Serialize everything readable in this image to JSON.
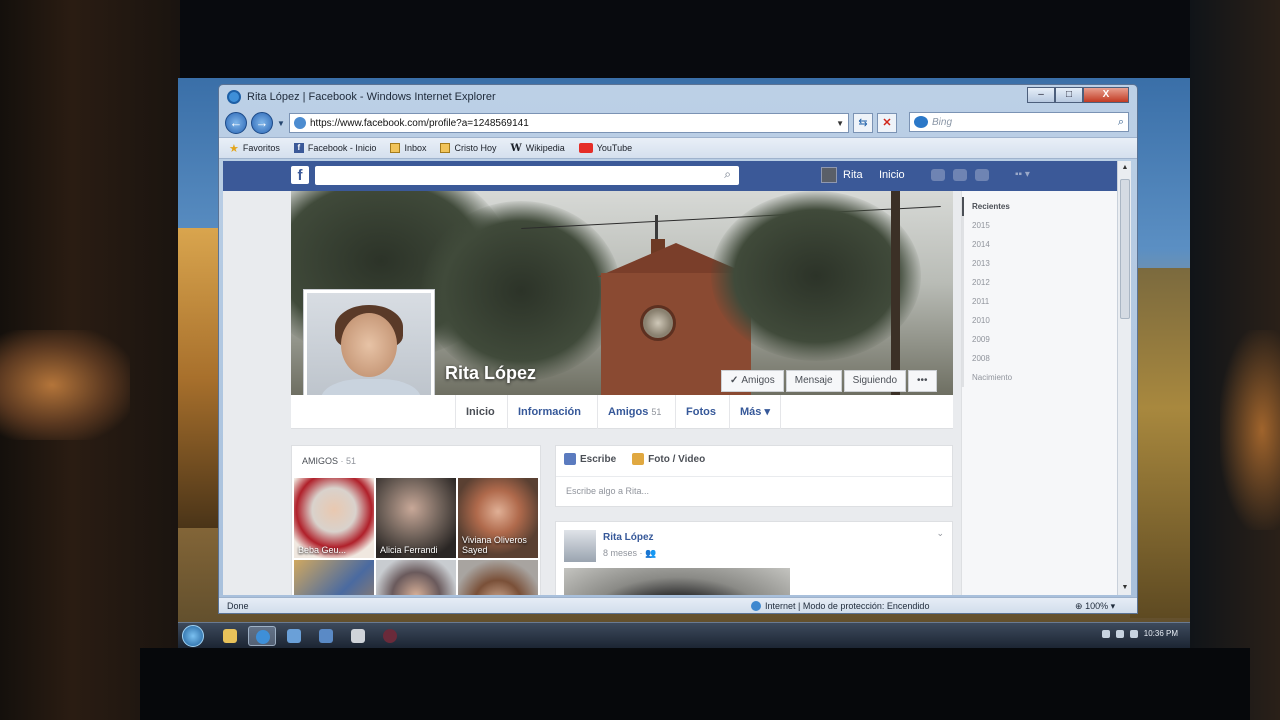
{
  "window": {
    "title": "Rita López | Facebook - Windows Internet Explorer",
    "controls": {
      "minimize": "–",
      "maximize": "□",
      "close": "X"
    }
  },
  "toolbar": {
    "back": "←",
    "forward": "→",
    "url": "https://www.facebook.com/profile?a=1248569141",
    "refresh": "⇆",
    "stop": "✕",
    "search_placeholder": "Bing"
  },
  "favorites": [
    {
      "label": "Favoritos",
      "icon": "star-icon"
    },
    {
      "label": "Facebook - Inicio",
      "icon": "facebook-icon"
    },
    {
      "label": "Inbox",
      "icon": "mail-icon"
    },
    {
      "label": "Cristo Hoy",
      "icon": "folder-icon"
    },
    {
      "label": "Wikipedia",
      "icon": "wikipedia-icon"
    },
    {
      "label": "YouTube",
      "icon": "youtube-icon"
    }
  ],
  "facebook": {
    "logo": "f",
    "user_name": "Rita",
    "home_label": "Inicio",
    "profile": {
      "name": "Rita López",
      "actions": {
        "friends": "Amigos",
        "message": "Mensaje",
        "following": "Siguiendo",
        "more": "•••"
      }
    },
    "tabs": [
      {
        "label": "Inicio"
      },
      {
        "label": "Información"
      },
      {
        "label": "Amigos",
        "count": "51"
      },
      {
        "label": "Fotos"
      },
      {
        "label": "Más ▾"
      }
    ],
    "friends_box": {
      "title": "AMIGOS",
      "count": "· 51",
      "friends": [
        {
          "name": "Beba Geu..."
        },
        {
          "name": "Alicia Ferrandi"
        },
        {
          "name": "Viviana Oliveros Sayed"
        },
        {
          "name": ""
        },
        {
          "name": ""
        },
        {
          "name": ""
        }
      ]
    },
    "composer": {
      "write_label": "Escribe",
      "photo_label": "Foto / Video",
      "placeholder": "Escribe algo a Rita..."
    },
    "post": {
      "author": "Rita López",
      "meta": "8 meses · ",
      "chevron": "⌄"
    },
    "timeline": [
      "Recientes",
      "2015",
      "2014",
      "2013",
      "2012",
      "2011",
      "2010",
      "2009",
      "2008",
      "Nacimiento"
    ]
  },
  "statusbar": {
    "left": "Done",
    "zone": "Internet | Modo de protección: Encendido",
    "zoom": "100%"
  },
  "taskbar": {
    "clock": "10:36 PM"
  }
}
